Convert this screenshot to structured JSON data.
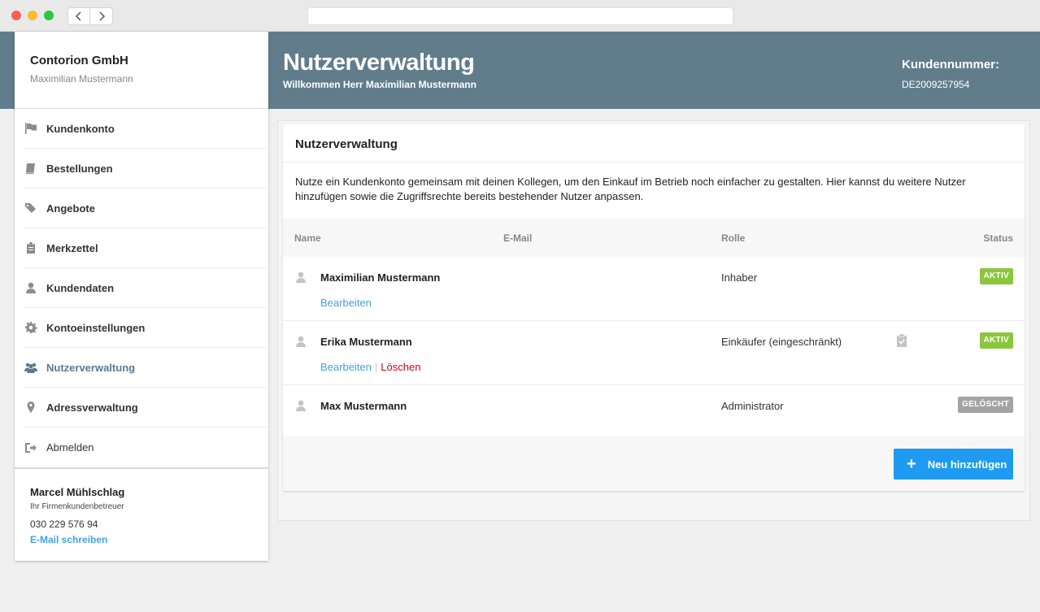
{
  "header": {
    "title": "Nutzerverwaltung",
    "welcome": "Willkommen Herr Maximilian Mustermann",
    "customer_number_label": "Kundennummer:",
    "customer_number": "DE2009257954"
  },
  "sidebar": {
    "company": "Contorion GmbH",
    "user": "Maximilian Mustermann",
    "items": [
      {
        "label": "Kundenkonto",
        "icon": "flag-icon"
      },
      {
        "label": "Bestellungen",
        "icon": "book-icon"
      },
      {
        "label": "Angebote",
        "icon": "tags-icon"
      },
      {
        "label": "Merkzettel",
        "icon": "clipboard-icon"
      },
      {
        "label": "Kundendaten",
        "icon": "user-icon"
      },
      {
        "label": "Kontoeinstellungen",
        "icon": "gear-icon"
      },
      {
        "label": "Nutzerverwaltung",
        "icon": "users-icon",
        "active": true
      },
      {
        "label": "Adressverwaltung",
        "icon": "map-marker-icon"
      },
      {
        "label": "Abmelden",
        "icon": "sign-out-icon"
      }
    ],
    "contact": {
      "name": "Marcel Mühlschlag",
      "role": "Ihr Firmenkundenbetreuer",
      "phone": "030 229 576 94",
      "mail_link": "E-Mail schreiben"
    }
  },
  "main": {
    "title": "Nutzerverwaltung",
    "description": "Nutze ein Kundenkonto gemeinsam mit deinen Kollegen, um den Einkauf im Betrieb noch einfacher zu gestalten. Hier kannst du weitere Nutzer hinzufügen sowie die Zugriffsrechte bereits bestehender Nutzer anpassen.",
    "columns": [
      "Name",
      "E-Mail",
      "Rolle",
      "Status"
    ],
    "rows": [
      {
        "name": "Maximilian Mustermann",
        "role": "Inhaber",
        "status": "AKTIV",
        "edit": "Bearbeiten"
      },
      {
        "name": "Erika Mustermann",
        "role": "Einkäufer (eingeschränkt)",
        "status": "AKTIV",
        "edit": "Bearbeiten",
        "delete": "Löschen"
      },
      {
        "name": "Max Mustermann",
        "role": "Administrator",
        "status": "GELÖSCHT"
      }
    ],
    "add_button": "Neu hinzufügen"
  },
  "colors": {
    "header_bg": "#617d8c",
    "accent_blue": "#1e9bf0",
    "link_blue": "#3ea3e8",
    "status_active": "#8cc63e",
    "status_deleted": "#a3a3a3",
    "delete_red": "#d0021b"
  }
}
